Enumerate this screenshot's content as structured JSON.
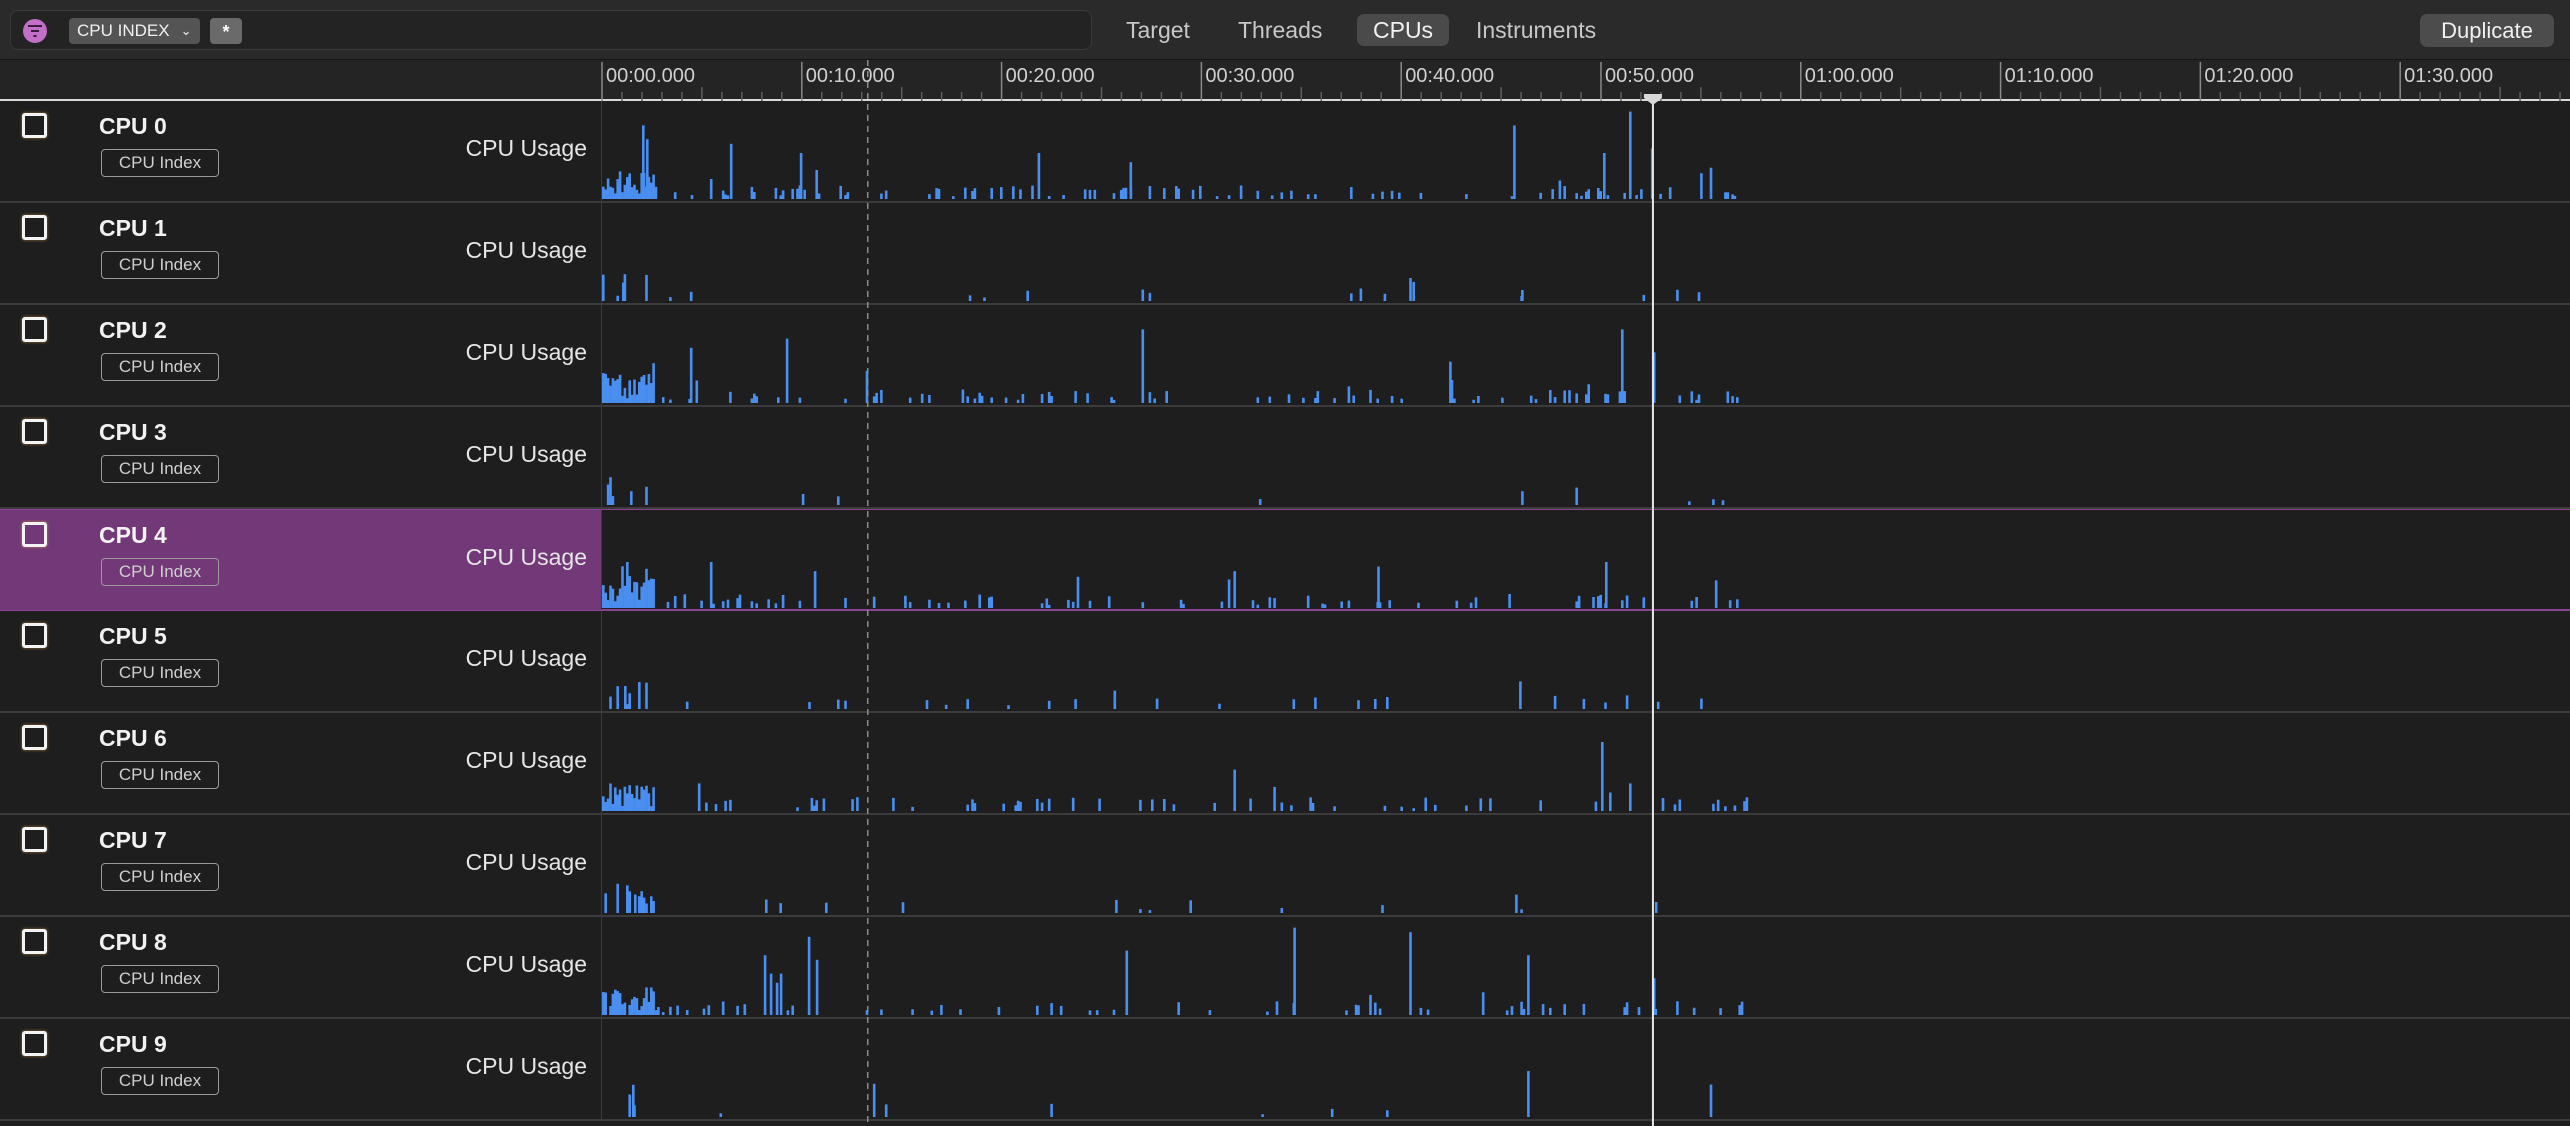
{
  "toolbar": {
    "filter_icon": "filter-icon",
    "scope_label": "CPU INDEX",
    "scope_chevron": "⌄",
    "asterisk_label": "*",
    "tabs": [
      {
        "label": "Target",
        "active": false
      },
      {
        "label": "Threads",
        "active": false
      },
      {
        "label": "CPUs",
        "active": true
      },
      {
        "label": "Instruments",
        "active": false
      }
    ],
    "duplicate_label": "Duplicate"
  },
  "ruler": {
    "ticks": [
      "00:00.000",
      "00:10.000",
      "00:20.000",
      "00:30.000",
      "00:40.000",
      "00:50.000",
      "01:00.000",
      "01:10.000",
      "01:20.000",
      "01:30.000"
    ],
    "visible_seconds": 98.5,
    "data_end_seconds": 57.3,
    "inspection_head_seconds": 52.6,
    "dashed_marker_seconds": 13.3
  },
  "colors": {
    "accent": "#c26fc8",
    "bar": "#4a8ff0",
    "selection": "#733878",
    "playhead": "#e8e8e8"
  },
  "tracks": [
    {
      "title": "CPU 0",
      "badge": "CPU Index",
      "metric": "CPU Usage",
      "selected": false,
      "seed": 11,
      "density": 0.55,
      "peaks": [
        [
          2.0,
          0.8
        ],
        [
          2.2,
          0.65
        ],
        [
          6.4,
          0.6
        ],
        [
          9.9,
          0.5
        ],
        [
          21.8,
          0.5
        ],
        [
          26.4,
          0.4
        ],
        [
          45.6,
          0.8
        ],
        [
          50.1,
          0.5
        ],
        [
          51.4,
          0.95
        ],
        [
          52.5,
          0.55
        ]
      ]
    },
    {
      "title": "CPU 1",
      "badge": "CPU Index",
      "metric": "CPU Usage",
      "selected": false,
      "seed": 23,
      "density": 0.07,
      "peaks": [
        [
          1.0,
          0.2
        ],
        [
          4.4,
          0.1
        ],
        [
          40.4,
          0.25
        ],
        [
          46.0,
          0.12
        ]
      ]
    },
    {
      "title": "CPU 2",
      "badge": "CPU Index",
      "metric": "CPU Usage",
      "selected": false,
      "seed": 37,
      "density": 0.5,
      "peaks": [
        [
          4.4,
          0.6
        ],
        [
          9.2,
          0.7
        ],
        [
          13.2,
          0.35
        ],
        [
          27.0,
          0.8
        ],
        [
          42.4,
          0.45
        ],
        [
          51.0,
          0.8
        ],
        [
          52.6,
          0.55
        ]
      ]
    },
    {
      "title": "CPU 3",
      "badge": "CPU Index",
      "metric": "CPU Usage",
      "selected": false,
      "seed": 41,
      "density": 0.04,
      "peaks": [
        [
          1.4,
          0.15
        ],
        [
          10.0,
          0.12
        ],
        [
          46.0,
          0.15
        ]
      ]
    },
    {
      "title": "CPU 4",
      "badge": "CPU Index",
      "metric": "CPU Usage",
      "selected": true,
      "seed": 53,
      "density": 0.5,
      "peaks": [
        [
          1.2,
          0.5
        ],
        [
          5.4,
          0.5
        ],
        [
          10.6,
          0.4
        ],
        [
          31.6,
          0.4
        ],
        [
          38.8,
          0.45
        ],
        [
          50.2,
          0.5
        ],
        [
          55.7,
          0.3
        ]
      ]
    },
    {
      "title": "CPU 5",
      "badge": "CPU Index",
      "metric": "CPU Usage",
      "selected": false,
      "seed": 67,
      "density": 0.1,
      "peaks": [
        [
          1.1,
          0.25
        ],
        [
          25.6,
          0.2
        ],
        [
          45.9,
          0.3
        ]
      ]
    },
    {
      "title": "CPU 6",
      "badge": "CPU Index",
      "metric": "CPU Usage",
      "selected": false,
      "seed": 79,
      "density": 0.45,
      "peaks": [
        [
          4.8,
          0.3
        ],
        [
          31.6,
          0.45
        ],
        [
          50.0,
          0.75
        ],
        [
          51.4,
          0.3
        ]
      ]
    },
    {
      "title": "CPU 7",
      "badge": "CPU Index",
      "metric": "CPU Usage",
      "selected": false,
      "seed": 83,
      "density": 0.06,
      "peaks": [
        [
          1.2,
          0.3
        ],
        [
          1.6,
          0.2
        ],
        [
          45.7,
          0.2
        ],
        [
          52.7,
          0.12
        ]
      ]
    },
    {
      "title": "CPU 8",
      "badge": "CPU Index",
      "metric": "CPU Usage",
      "selected": false,
      "seed": 97,
      "density": 0.35,
      "peaks": [
        [
          8.4,
          0.45
        ],
        [
          8.7,
          0.35
        ],
        [
          8.9,
          0.45
        ],
        [
          8.1,
          0.65
        ],
        [
          10.3,
          0.85
        ],
        [
          10.7,
          0.6
        ],
        [
          26.2,
          0.7
        ],
        [
          34.6,
          0.95
        ],
        [
          40.4,
          0.9
        ],
        [
          46.3,
          0.65
        ],
        [
          52.6,
          0.4
        ]
      ]
    },
    {
      "title": "CPU 9",
      "badge": "CPU Index",
      "metric": "CPU Usage",
      "selected": false,
      "seed": 103,
      "density": 0.06,
      "peaks": [
        [
          1.5,
          0.35
        ],
        [
          46.3,
          0.5
        ]
      ]
    }
  ]
}
